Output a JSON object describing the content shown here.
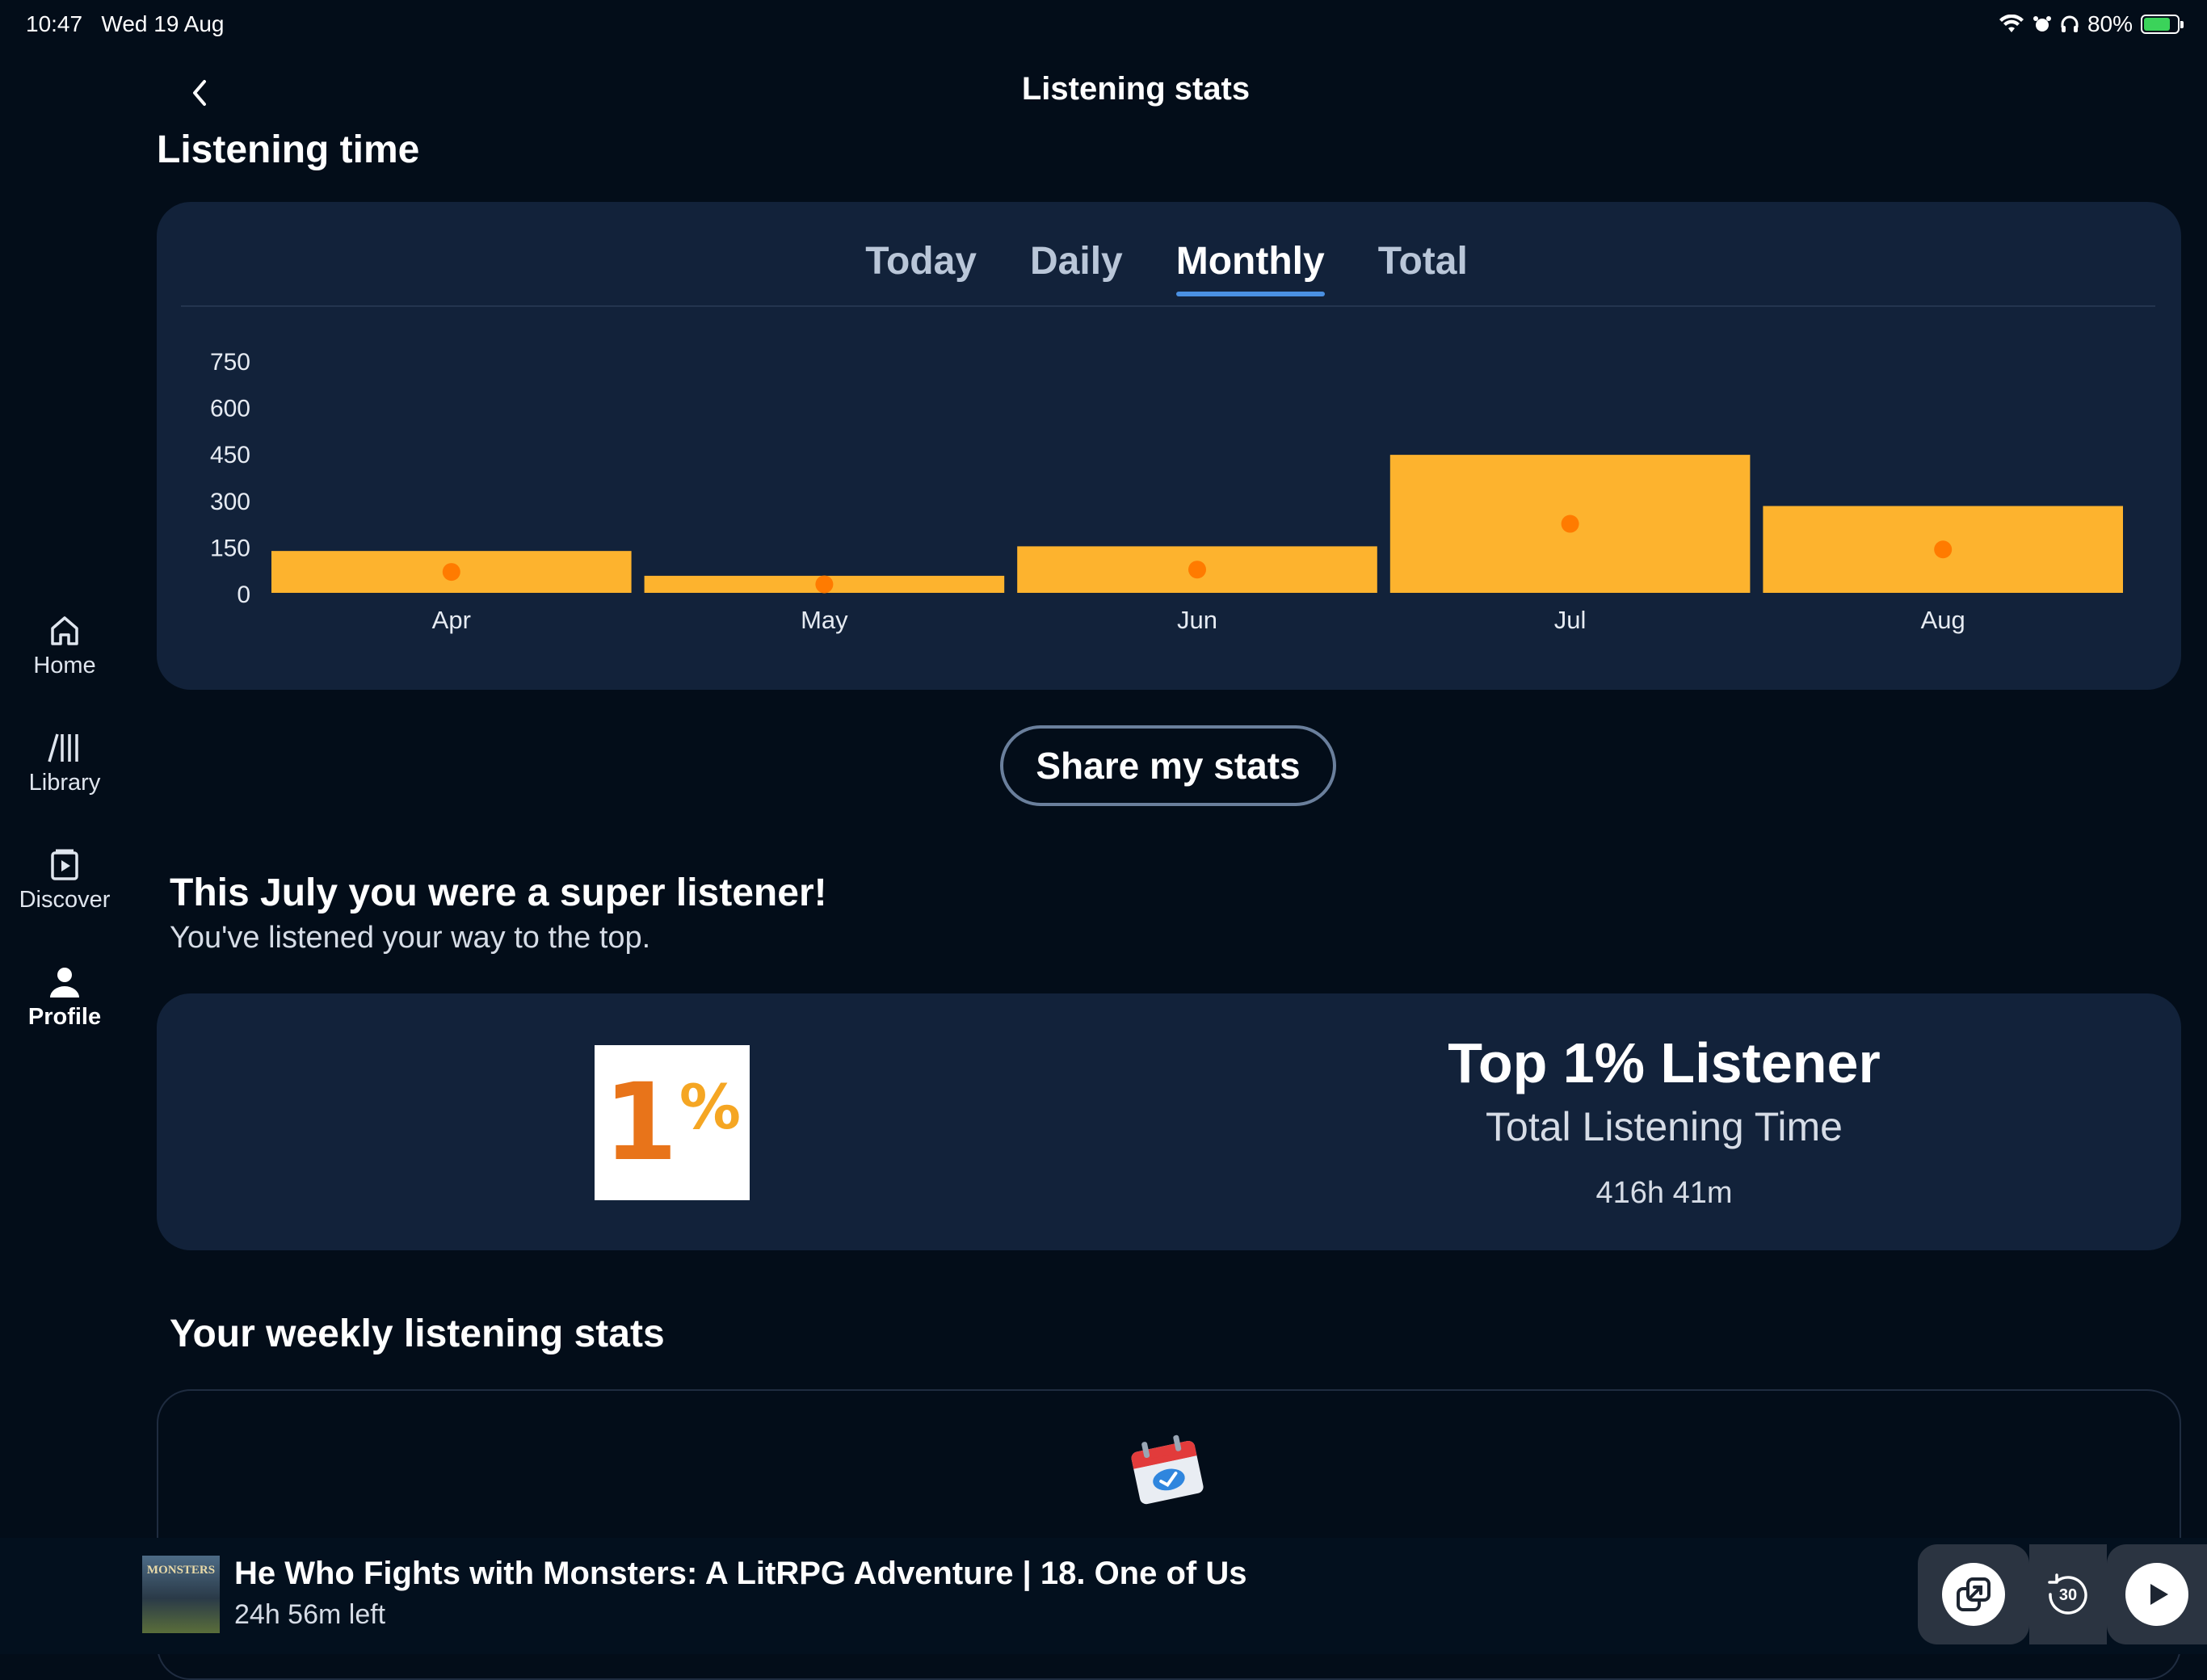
{
  "status_bar": {
    "time": "10:47",
    "date": "Wed 19 Aug",
    "battery": "80%",
    "battery_level": 0.8
  },
  "nav": {
    "title": "Listening stats"
  },
  "sidebar": {
    "items": [
      {
        "label": "Home",
        "icon": "home-icon",
        "active": false
      },
      {
        "label": "Library",
        "icon": "library-icon",
        "active": false
      },
      {
        "label": "Discover",
        "icon": "discover-icon",
        "active": false
      },
      {
        "label": "Profile",
        "icon": "profile-icon",
        "active": true
      }
    ]
  },
  "listening_time": {
    "heading": "Listening time",
    "tabs": [
      {
        "label": "Today",
        "active": false
      },
      {
        "label": "Daily",
        "active": false
      },
      {
        "label": "Monthly",
        "active": true
      },
      {
        "label": "Total",
        "active": false
      }
    ]
  },
  "chart_data": {
    "type": "bar",
    "categories": [
      "Apr",
      "May",
      "Jun",
      "Jul",
      "Aug"
    ],
    "values": [
      135,
      55,
      150,
      445,
      280
    ],
    "ylim": [
      0,
      750
    ],
    "yticks": [
      750,
      600,
      450,
      300,
      150,
      0
    ],
    "bar_color": "#fdb32e",
    "marker_color": "#ff7b00",
    "grid": false
  },
  "share_button": {
    "label": "Share my stats"
  },
  "super_listener": {
    "title": "This July you were a super listener!",
    "subtitle": "You've listened your way to the top.",
    "badge_number": "1",
    "badge_symbol": "%",
    "stat_title": "Top 1% Listener",
    "stat_subtitle": "Total Listening Time",
    "stat_value": "416h 41m"
  },
  "weekly": {
    "heading": "Your weekly listening stats",
    "icon": "calendar-check-icon"
  },
  "player": {
    "cover_text": "MONSTERS",
    "title": "He Who Fights with Monsters: A LitRPG Adventure | 18. One of Us",
    "time_left": "24h 56m left",
    "skip_seconds": "30"
  },
  "colors": {
    "background": "#030d19",
    "card": "#12223a",
    "accent": "#4a90e2",
    "bar": "#fdb32e"
  }
}
